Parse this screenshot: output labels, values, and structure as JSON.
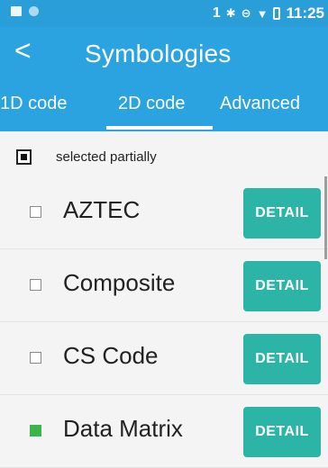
{
  "status_bar": {
    "notification_number": "1",
    "bluetooth_glyph": "✱",
    "time": "11:25"
  },
  "app_bar": {
    "back_glyph": "<",
    "title": "Symbologies"
  },
  "tabs": [
    {
      "label": "1D code",
      "selected": false
    },
    {
      "label": "2D code",
      "selected": true
    },
    {
      "label": "Advanced",
      "selected": false
    }
  ],
  "partial_selection": {
    "label": "selected partially"
  },
  "items": [
    {
      "name": "AZTEC",
      "checked": false,
      "button_label": "DETAIL"
    },
    {
      "name": "Composite",
      "checked": false,
      "button_label": "DETAIL"
    },
    {
      "name": "CS Code",
      "checked": false,
      "button_label": "DETAIL"
    },
    {
      "name": "Data Matrix",
      "checked": true,
      "button_label": "DETAIL"
    }
  ],
  "colors": {
    "status_bar": "#2a9ed8",
    "app_bar": "#2aa3e0",
    "detail_button": "#2cb4a6",
    "checked": "#3bb54a"
  }
}
